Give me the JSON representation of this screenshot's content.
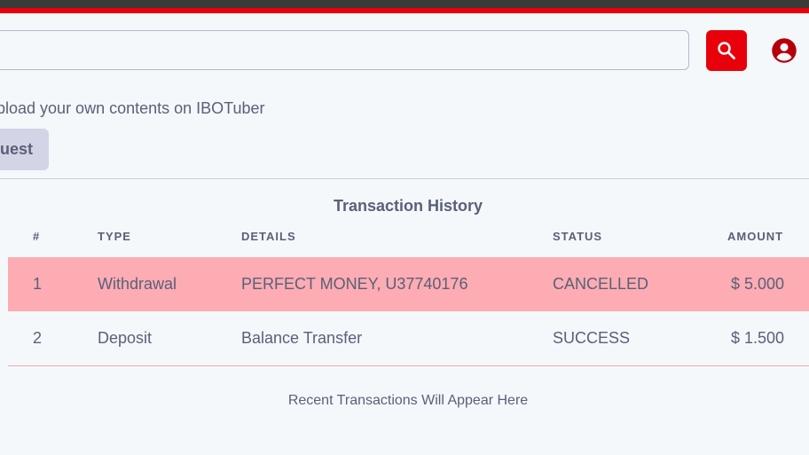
{
  "colors": {
    "brand_red": "#e8000b",
    "top_dark": "#3a3a3a",
    "text": "#5a6078",
    "cancelled_row": "#fdacb3",
    "request_button_bg": "#d3d5e6",
    "page_bg": "#f5f8fb"
  },
  "header": {
    "search": {
      "value": "",
      "placeholder": "",
      "button_icon": "search-icon"
    },
    "account_icon": "account-circle-icon"
  },
  "upload": {
    "text": "pload your own contents on IBOTuber",
    "button_label": "uest"
  },
  "transactions": {
    "title": "Transaction History",
    "columns": [
      "#",
      "TYPE",
      "DETAILS",
      "STATUS",
      "AMOUNT"
    ],
    "rows": [
      {
        "num": "1",
        "type": "Withdrawal",
        "details": "PERFECT MONEY, U37740176",
        "status": "CANCELLED",
        "amount": "$ 5.000"
      },
      {
        "num": "2",
        "type": "Deposit",
        "details": "Balance Transfer",
        "status": "SUCCESS",
        "amount": "$ 1.500"
      }
    ],
    "footer_note": "Recent Transactions Will Appear Here"
  }
}
